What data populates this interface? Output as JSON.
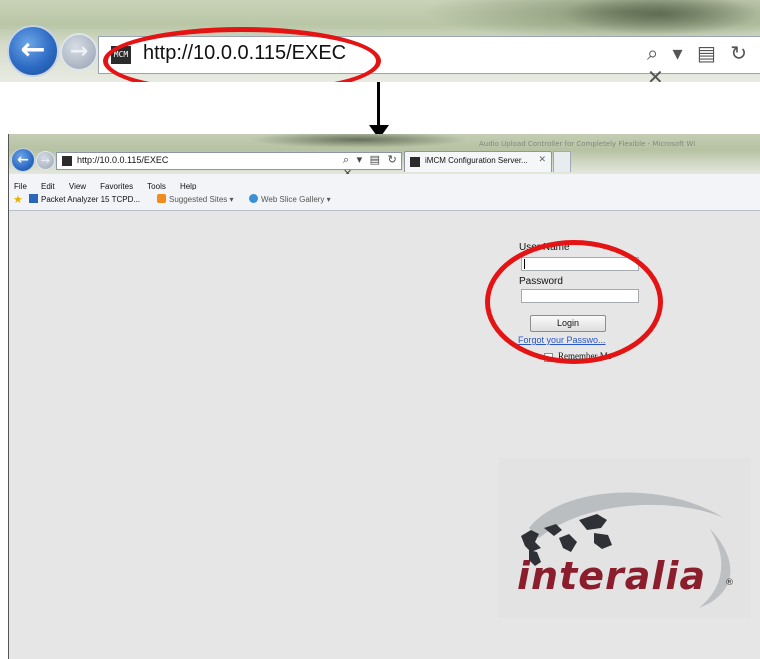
{
  "zoomed_bar": {
    "url": "http://10.0.0.115/EXEC",
    "tools": "⌕ ▾ ▤ ↻ ✕"
  },
  "browser": {
    "title_text": "Audio Upload Controller for Completely Flexible - Microsoft Wi",
    "address": "http://10.0.0.115/EXEC",
    "address_tools": "⌕ ▾ ▤ ↻ ✕",
    "tab_label": "iMCM Configuration Server...",
    "menu": [
      "File",
      "Edit",
      "View",
      "Favorites",
      "Tools",
      "Help"
    ],
    "favorites": {
      "packet": "Packet Analyzer 15 TCPD...",
      "suggested": "Suggested Sites ▾",
      "webslice": "Web Slice Gallery ▾"
    }
  },
  "login": {
    "username_label": "User Name",
    "password_label": "Password",
    "login_button": "Login",
    "forgot_link": "Forgot your Passwo...",
    "remember_label": "Remember Me"
  },
  "logo": {
    "text": "interalia",
    "registered": "®"
  },
  "colors": {
    "annotation_ring": "#e41414",
    "logo_text": "#8b1e2c",
    "link": "#2a56c6"
  }
}
